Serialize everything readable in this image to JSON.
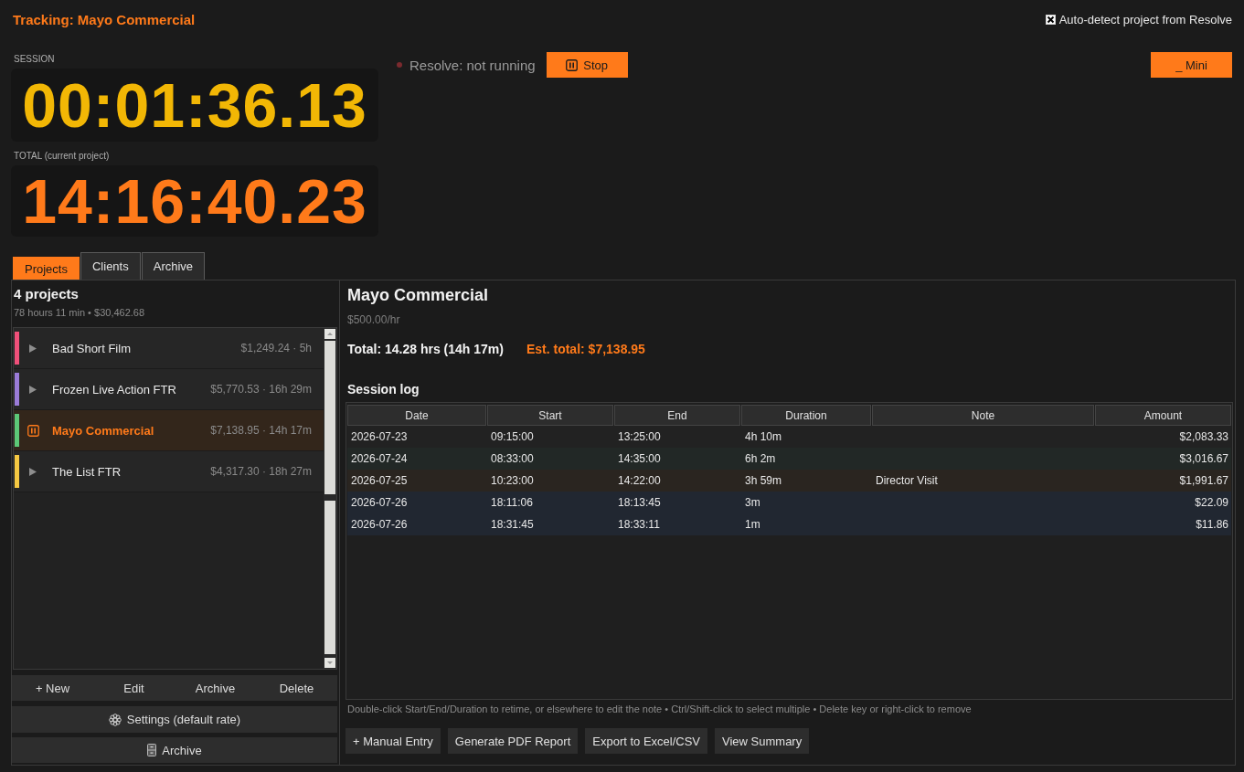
{
  "header": {
    "title": "Tracking: Mayo Commercial",
    "auto_detect": {
      "label": "Auto-detect project from Resolve",
      "checked": true
    }
  },
  "timers": [
    {
      "kind": "session",
      "label": "SESSION",
      "value": "00:01:36.13"
    },
    {
      "kind": "total",
      "label": "TOTAL (current project)",
      "value": "14:16:40.23"
    }
  ],
  "resolve_status": {
    "text": "Resolve: not running",
    "running": false
  },
  "stop_button": {
    "label": "Stop"
  },
  "mini_button": {
    "label": "_ Mini"
  },
  "tabs": [
    {
      "label": "Projects",
      "selected": true
    },
    {
      "label": "Clients",
      "selected": false
    },
    {
      "label": "Archive",
      "selected": false
    }
  ],
  "projects": {
    "title": "4 projects",
    "summary": "78 hours 11 min • $30,462.68",
    "items": [
      {
        "name": "Bad Short Film",
        "meta": "$1,249.24 · 5h",
        "color": "#f0507a",
        "selected": false,
        "tracking": false
      },
      {
        "name": "Frozen Live Action FTR",
        "meta": "$5,770.53 · 16h 29m",
        "color": "#9a7bd8",
        "selected": false,
        "tracking": false
      },
      {
        "name": "Mayo Commercial",
        "meta": "$7,138.95 · 14h 17m",
        "color": "#5cc878",
        "selected": true,
        "tracking": true
      },
      {
        "name": "The List FTR",
        "meta": "$4,317.30 · 18h 27m",
        "color": "#f5c842",
        "selected": false,
        "tracking": false
      }
    ],
    "actions": [
      "+ New",
      "Edit",
      "Archive",
      "Delete"
    ],
    "settings_button": "Settings (default rate)",
    "archive_button": "Archive"
  },
  "detail": {
    "title": "Mayo Commercial",
    "rate": "$500.00/hr",
    "total": "Total: 14.28 hrs (14h 17m)",
    "estimate": "Est. total: $7,138.95"
  },
  "session_log": {
    "title": "Session log",
    "columns": [
      "Date",
      "Start",
      "End",
      "Duration",
      "Note",
      "Amount"
    ],
    "rows": [
      {
        "color": "#222222",
        "date": "2026-07-23",
        "start": "09:15:00",
        "end": "13:25:00",
        "duration": "4h 10m",
        "amount": "$2,083.33"
      },
      {
        "color": "#222826",
        "date": "2026-07-24",
        "start": "08:33:00",
        "end": "14:35:00",
        "duration": "6h 2m",
        "amount": "$3,016.67"
      },
      {
        "color": "#2a2520",
        "date": "2026-07-25",
        "start": "10:23:00",
        "end": "14:22:00",
        "duration": "3h 59m",
        "note": "Director Visit",
        "amount": "$1,991.67"
      },
      {
        "color": "#212731",
        "date": "2026-07-26",
        "start": "18:11:06",
        "end": "18:13:45",
        "duration": "3m",
        "amount": "$22.09"
      },
      {
        "color": "#212731",
        "date": "2026-07-26",
        "start": "18:31:45",
        "end": "18:33:11",
        "duration": "1m",
        "amount": "$11.86"
      }
    ],
    "hint": "Double-click Start/End/Duration to retime, or elsewhere to edit the note • Ctrl/Shift-click to select multiple • Delete key or right-click to remove",
    "buttons": [
      "+ Manual Entry",
      "Generate PDF Report",
      "Export to Excel/CSV",
      "View Summary"
    ]
  }
}
